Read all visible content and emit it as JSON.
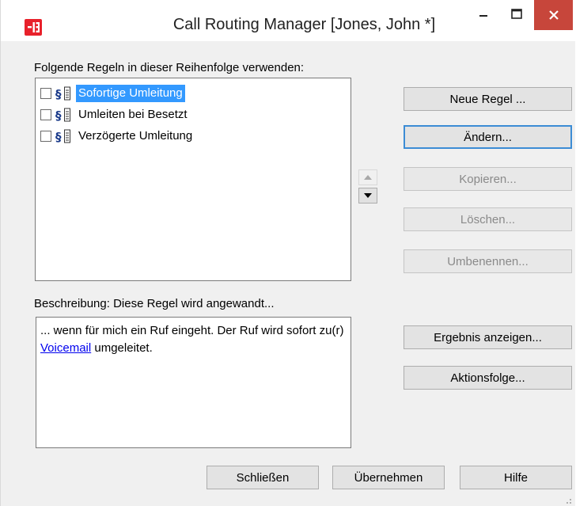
{
  "window": {
    "title": "Call Routing Manager [Jones, John *]"
  },
  "rules_section": {
    "label": "Folgende Regeln in dieser Reihenfolge verwenden:",
    "items": [
      {
        "label": "Sofortige Umleitung",
        "checked": false,
        "selected": true
      },
      {
        "label": "Umleiten bei Besetzt",
        "checked": false,
        "selected": false
      },
      {
        "label": "Verzögerte Umleitung",
        "checked": false,
        "selected": false
      }
    ]
  },
  "rule_buttons": {
    "new": "Neue Regel ...",
    "edit": "Ändern...",
    "copy": "Kopieren...",
    "delete": "Löschen...",
    "rename": "Umbenennen..."
  },
  "description": {
    "label": "Beschreibung: Diese Regel wird angewandt...",
    "text_before": "... wenn für mich ein Ruf eingeht. Der Ruf wird sofort zu(r) ",
    "link": "Voicemail",
    "text_after": " umgeleitet."
  },
  "description_buttons": {
    "show_result": "Ergebnis anzeigen...",
    "action_sequence": "Aktionsfolge..."
  },
  "footer": {
    "close": "Schließen",
    "apply": "Übernehmen",
    "help": "Hilfe"
  },
  "colors": {
    "selection": "#3399ff",
    "close_button": "#c7463b",
    "app_icon": "#e8212b",
    "link": "#0000ee"
  }
}
